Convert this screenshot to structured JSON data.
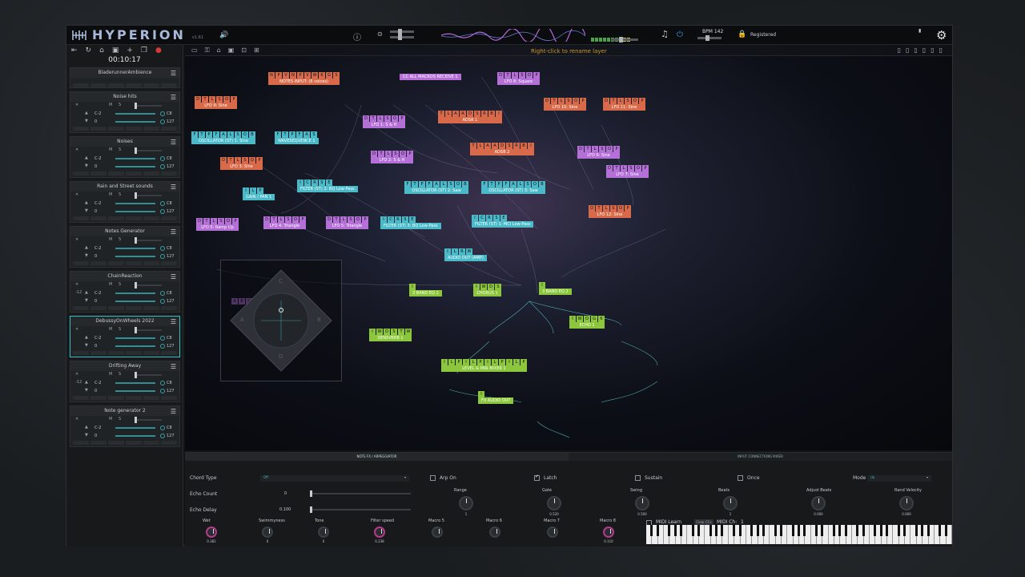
{
  "app": {
    "title": "HYPERION",
    "version": "v1.61"
  },
  "topbar": {
    "bpm": "BPM 142",
    "registered": "Registered"
  },
  "sidebar": {
    "timer": "00:10:17",
    "first_layer": "BladerunnerAmbience",
    "layers": [
      {
        "name": "Noise hits",
        "note_lo": "C-2",
        "note_hi": "C8",
        "vel_lo": "0",
        "vel_hi": "127",
        "transpose": ""
      },
      {
        "name": "Noises",
        "note_lo": "C-2",
        "note_hi": "C8",
        "vel_lo": "0",
        "vel_hi": "127",
        "transpose": ""
      },
      {
        "name": "Rain and Street sounds",
        "note_lo": "C-2",
        "note_hi": "C8",
        "vel_lo": "0",
        "vel_hi": "127",
        "transpose": ""
      },
      {
        "name": "Notes Generator",
        "note_lo": "C-2",
        "note_hi": "C8",
        "vel_lo": "0",
        "vel_hi": "127",
        "transpose": ""
      },
      {
        "name": "ChainReaction",
        "note_lo": "C-2",
        "note_hi": "C8",
        "vel_lo": "0",
        "vel_hi": "127",
        "transpose": "-12"
      },
      {
        "name": "DebussyOnWheels 2022",
        "note_lo": "C-2",
        "note_hi": "C8",
        "vel_lo": "0",
        "vel_hi": "127",
        "transpose": ""
      },
      {
        "name": "Drifting Away",
        "note_lo": "C-2",
        "note_hi": "C8",
        "vel_lo": "0",
        "vel_hi": "127",
        "transpose": "-12"
      },
      {
        "name": "Note generator 2",
        "note_lo": "C-2",
        "note_hi": "C8",
        "vel_lo": "0",
        "vel_hi": "127",
        "transpose": ""
      }
    ]
  },
  "canvas": {
    "hint": "Right-click to rename layer",
    "nodes": [
      {
        "label": "NOTES INPUT: (6 voices)",
        "color": "or",
        "pins": "NPVNPVWKGS"
      },
      {
        "label": "LFO 8: Square",
        "color": "pu",
        "pins": "DTLSOP"
      },
      {
        "label": "CC ALL MACROS RECEIVE 1",
        "color": "pu",
        "pins": ""
      },
      {
        "label": "LFO 9: Sine",
        "color": "or",
        "pins": "DTLSOP"
      },
      {
        "label": "LFO 1: S & H",
        "color": "pu",
        "pins": "DTLSOP"
      },
      {
        "label": "ADSR 1",
        "color": "or",
        "pins": "TLAADSRBI"
      },
      {
        "label": "LFO 10: Sine",
        "color": "or",
        "pins": "DTLSOP"
      },
      {
        "label": "LFO 11: Sine",
        "color": "or",
        "pins": "DTLSOP"
      },
      {
        "label": "OSCILLATOR (ST) 1: Sine",
        "color": "cy",
        "pins": "FTPFALSOB"
      },
      {
        "label": "WAVESEQUENCE 1",
        "color": "cy",
        "pins": "FTPFAS"
      },
      {
        "label": "LFO 2: S & H",
        "color": "pu",
        "pins": "DTLSOP"
      },
      {
        "label": "ADSR 2",
        "color": "or",
        "pins": "TLAADSRBI"
      },
      {
        "label": "LFO 6: Sine",
        "color": "pu",
        "pins": "DTLSOP"
      },
      {
        "label": "LFO 3: Sine",
        "color": "or",
        "pins": "DTLSOP"
      },
      {
        "label": "LFO 7: Sine",
        "color": "pu",
        "pins": "DTLSOP"
      },
      {
        "label": "FILTER (ST) 2: BQ Low-Pass",
        "color": "cy",
        "pins": "ICRSE"
      },
      {
        "label": "OSCILLATOR (ST) 2: Saw",
        "color": "cy",
        "pins": "FTPFALSOB"
      },
      {
        "label": "OSCILLATOR (ST) 3: Saw",
        "color": "cy",
        "pins": "FTPFALSOB"
      },
      {
        "label": "GAIN / PAN 1",
        "color": "cy",
        "pins": "ILP"
      },
      {
        "label": "LFO 12: Sine",
        "color": "or",
        "pins": "DTLSOP"
      },
      {
        "label": "LFO 5: Ramp Up",
        "color": "pu",
        "pins": "DTLSOP"
      },
      {
        "label": "LFO 4: Triangle",
        "color": "pu",
        "pins": "DTLSOP"
      },
      {
        "label": "LFO 5: Triangle",
        "color": "pu",
        "pins": "DTLSOP"
      },
      {
        "label": "FILTER (ST) 3: BQ Low-Pass",
        "color": "cy",
        "pins": "ICRSE"
      },
      {
        "label": "FILTER (ST) 1: MCI Low-Pass",
        "color": "cy",
        "pins": "ICRSE"
      },
      {
        "label": "AUDIO OUT (AMP)",
        "color": "cy",
        "pins": "ILRW"
      },
      {
        "label": "3 BAND EQ 1",
        "color": "gr",
        "pins": "I"
      },
      {
        "label": "CHORUS 1",
        "color": "gr",
        "pins": "IWDS"
      },
      {
        "label": "3 BAND EQ 2",
        "color": "gr",
        "pins": "I"
      },
      {
        "label": "ECHO 1",
        "color": "gr",
        "pins": "IWOGK"
      },
      {
        "label": "DENSVERB 1",
        "color": "gr",
        "pins": "IWDSTW"
      },
      {
        "label": "LEVEL & PAN MIXER 1",
        "color": "gr",
        "pins": "ILPILPILPILP"
      },
      {
        "label": "FX AUDIO OUT",
        "color": "gr",
        "pins": "I"
      }
    ],
    "xy": {
      "pins": "ABCDXY",
      "a": "A",
      "b": "B",
      "c": "C",
      "d": "D"
    }
  },
  "bottom": {
    "tab_left": "NOTE FX / ARPEGGIATOR",
    "tab_right": "INPUT CONNECTIONS MIXER",
    "chord_type": "Chord Type",
    "chord_value": "Off",
    "echo_count": "Echo Count",
    "echo_count_val": "0",
    "echo_delay": "Echo Delay",
    "echo_delay_val": "0.100",
    "arp_on": "Arp On",
    "latch": "Latch",
    "sustain": "Sustain",
    "once": "Once",
    "mode": "Mode",
    "mode_value": "Up",
    "knobs1": [
      {
        "label": "Range",
        "value": "1"
      },
      {
        "label": "Gate",
        "value": "0.520"
      },
      {
        "label": "Swing",
        "value": "0.500"
      },
      {
        "label": "Beats",
        "value": "1"
      },
      {
        "label": "Adjust Beats",
        "value": "0.000"
      },
      {
        "label": "Rand Velocity",
        "value": "0.000"
      }
    ],
    "knobs2": [
      {
        "label": "Wet",
        "value": "0.381"
      },
      {
        "label": "Swimmyness",
        "value": "0"
      },
      {
        "label": "Tone",
        "value": "0"
      },
      {
        "label": "Filter speed",
        "value": "0.238"
      },
      {
        "label": "Macro 5",
        "value": ""
      },
      {
        "label": "Macro 6",
        "value": ""
      },
      {
        "label": "Macro 7",
        "value": ""
      },
      {
        "label": "Macro 8",
        "value": "0.110"
      }
    ],
    "midi_learn": "MIDI Learn",
    "clear_ccs": "Clear CCs",
    "midi_ch": "MIDI Ch:",
    "midi_ch_val": "1"
  }
}
